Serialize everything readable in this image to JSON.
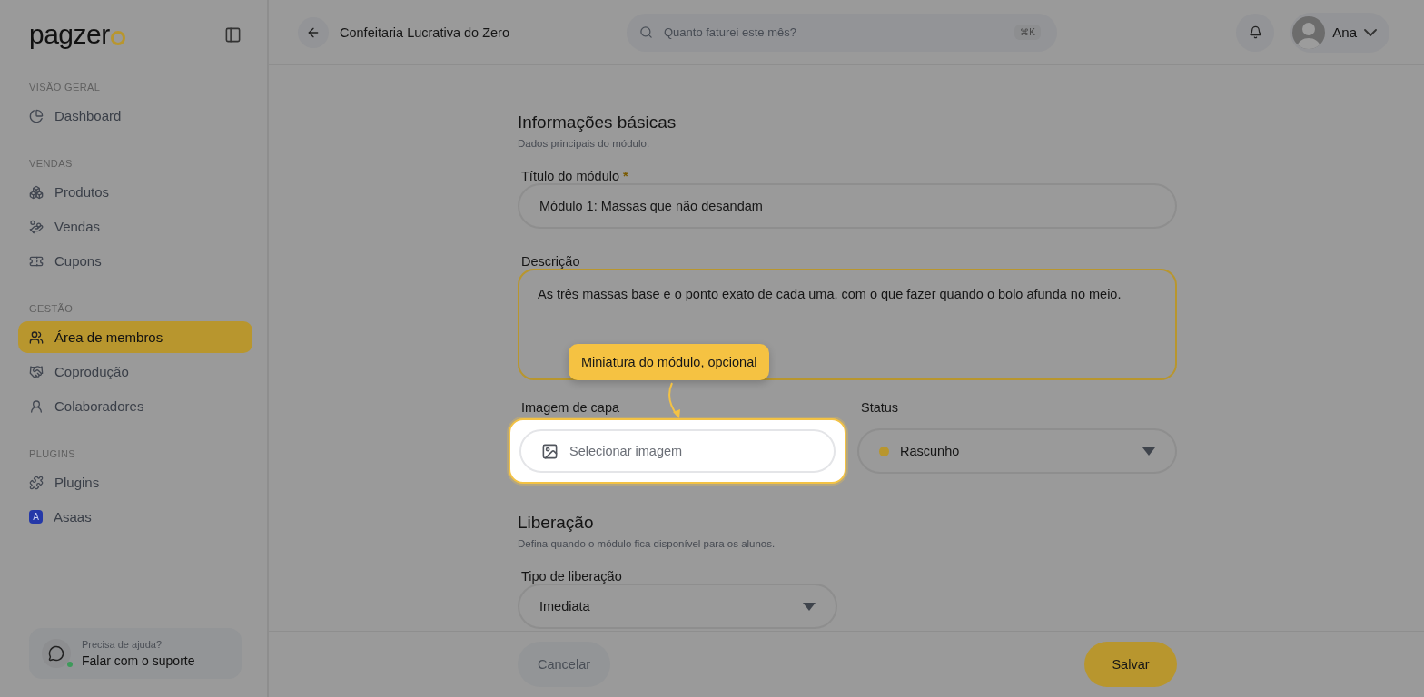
{
  "sidebar": {
    "logo": "pagzer",
    "sections": [
      {
        "title": "VISÃO GERAL",
        "items": [
          {
            "label": "Dashboard",
            "selected": false
          }
        ]
      },
      {
        "title": "VENDAS",
        "items": [
          {
            "label": "Produtos",
            "selected": false
          },
          {
            "label": "Vendas",
            "selected": false
          },
          {
            "label": "Cupons",
            "selected": false
          }
        ]
      },
      {
        "title": "GESTÃO",
        "items": [
          {
            "label": "Área de membros",
            "selected": true
          },
          {
            "label": "Coprodução",
            "selected": false
          },
          {
            "label": "Colaboradores",
            "selected": false
          }
        ]
      },
      {
        "title": "PLUGINS",
        "items": [
          {
            "label": "Plugins",
            "selected": false
          },
          {
            "label": "Asaas",
            "letter": "A",
            "selected": false
          }
        ]
      }
    ],
    "support": {
      "caption": "Precisa de ajuda?",
      "label": "Falar com o suporte"
    }
  },
  "header": {
    "title": "Confeitaria Lucrativa do Zero",
    "search": {
      "placeholder": "Quanto faturei este mês?",
      "shortcut": "⌘K"
    },
    "user": "Ana"
  },
  "basics": {
    "title": "Informações básicas",
    "subtitle": "Dados principais do módulo.",
    "title_label": "Título do módulo",
    "required_mark": "*",
    "title_value": "Módulo 1: Massas que não desandam",
    "description_label": "Descrição",
    "description_value": "As três massas base e o ponto exato de cada uma, com o que fazer quando o bolo afunda no meio.",
    "cover_label": "Imagem de capa",
    "cover_placeholder": "Selecionar imagem",
    "status_label": "Status",
    "status_value": "Rascunho"
  },
  "release": {
    "title": "Liberação",
    "subtitle": "Defina quando o módulo fica disponível para os alunos.",
    "type_label": "Tipo de liberação",
    "type_value": "Imediata"
  },
  "tooltip": "Miniatura do módulo, opcional",
  "footer": {
    "cancel": "Cancelar",
    "save": "Salvar"
  }
}
